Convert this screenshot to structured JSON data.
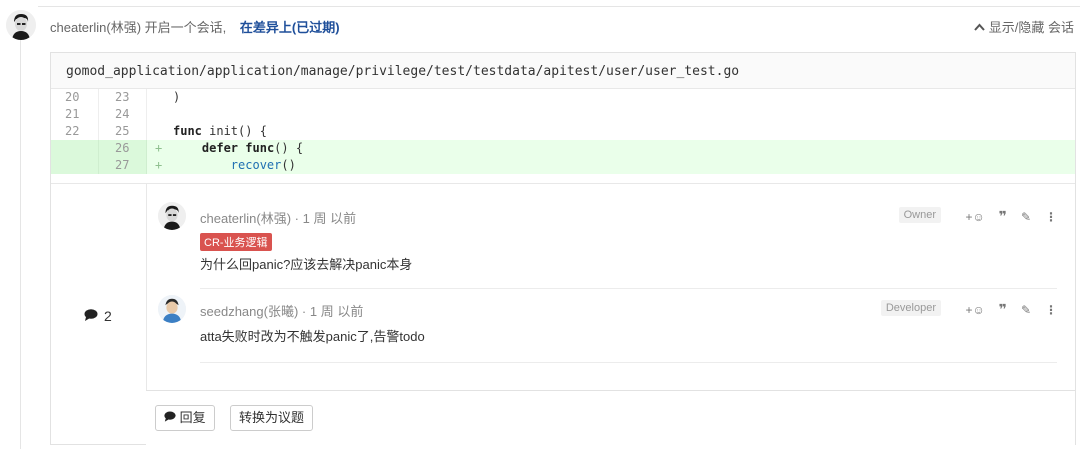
{
  "thread": {
    "author": "cheaterlin(林强)",
    "action": "开启一个会话,",
    "link": "在差异上(已过期)",
    "toggle_label": "显示/隐藏 会话"
  },
  "file": {
    "path": "gomod_application/application/manage/privilege/test/testdata/apitest/user/user_test.go",
    "lines": [
      {
        "old": "20",
        "new": "23",
        "sign": "",
        "type": "context"
      },
      {
        "old": "21",
        "new": "24",
        "sign": "",
        "type": "context"
      },
      {
        "old": "22",
        "new": "25",
        "sign": "",
        "type": "context"
      },
      {
        "old": "",
        "new": "26",
        "sign": "+",
        "type": "added"
      },
      {
        "old": "",
        "new": "27",
        "sign": "+",
        "type": "added"
      }
    ],
    "code_text": {
      "l1": ")",
      "l3_kw": "func",
      "l3_rest": " init() {",
      "l4_indent": "    ",
      "l4_kw1": "defer",
      "l4_kw2": "func",
      "l4_rest": "() {",
      "l5_indent": "        ",
      "l5_fn": "recover",
      "l5_rest": "()"
    }
  },
  "discussion": {
    "count": "2",
    "comments": [
      {
        "author": "cheaterlin(林强)",
        "time": "1 周 以前",
        "separator": "·",
        "label": "CR-业务逻辑",
        "body": "为什么回panic?应该去解决panic本身",
        "role": "Owner"
      },
      {
        "author": "seedzhang(张曦)",
        "time": "1 周 以前",
        "separator": "·",
        "body": "atta失败时改为不触发panic了,告警todo",
        "role": "Developer"
      }
    ],
    "actions": {
      "emoji": "+☺",
      "quote": "❞",
      "edit": "✎",
      "more": "⋮"
    },
    "reply_label": "回复",
    "convert_label": "转换为议题"
  }
}
